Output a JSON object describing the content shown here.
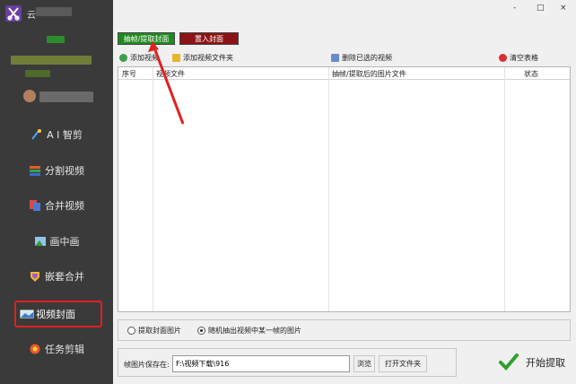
{
  "app": {
    "title": "云",
    "logo_icon": "scissors-logo-icon"
  },
  "sidebar": {
    "items": [
      {
        "label": "A I 智剪",
        "icon": "ai-icon"
      },
      {
        "label": "分割视频",
        "icon": "split-icon"
      },
      {
        "label": "合并视频",
        "icon": "merge-icon"
      },
      {
        "label": "画中画",
        "icon": "picture-in-picture-icon"
      },
      {
        "label": "嵌套合并",
        "icon": "nested-merge-icon"
      },
      {
        "label": "视频封面",
        "icon": "video-cover-icon",
        "active": true
      },
      {
        "label": "任务剪辑",
        "icon": "task-icon"
      }
    ]
  },
  "window": {
    "minimize": "-",
    "maximize": "□",
    "close": "×"
  },
  "tabs": {
    "extract_cover": "抽帧/提取封面",
    "import_cover": "置入封面"
  },
  "toolbar": {
    "add_video": "添加视频",
    "add_folder": "添加视频文件夹",
    "delete_selected": "删除已选的视频",
    "clear_table": "清空表格"
  },
  "table": {
    "columns": [
      "序号",
      "视频文件",
      "抽帧/提取后的图片文件",
      "状态"
    ],
    "rows": []
  },
  "options": {
    "extract_cover_image": "提取封面图片",
    "random_frame": "随机抽出视频中某一帧的图片",
    "selected": "random_frame"
  },
  "save": {
    "label": "帧图片保存在:",
    "path": "F:\\视频下载\\916",
    "browse": "浏览",
    "open_folder": "打开文件夹"
  },
  "start_button": "开始提取",
  "colors": {
    "sidebar_bg": "#3a3a3a",
    "active_border": "#e02020",
    "tab_green": "#1f8a1f",
    "tab_red": "#8c1414"
  }
}
